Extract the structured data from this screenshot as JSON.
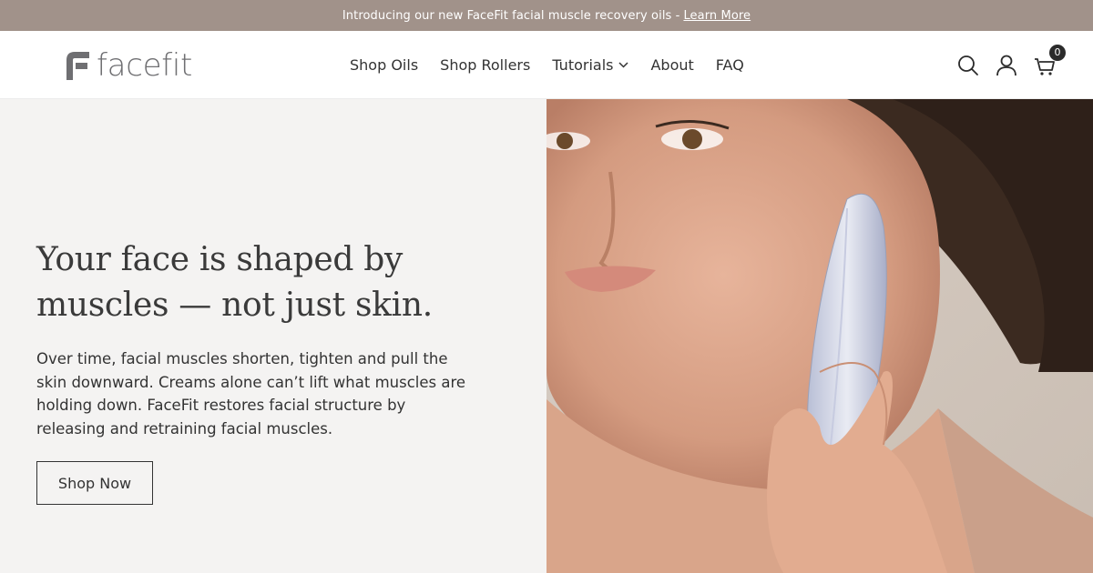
{
  "announcement": {
    "text": "Introducing our new FaceFit facial muscle recovery oils -",
    "link_label": "Learn More"
  },
  "header": {
    "logo_text": "facefit",
    "nav": [
      {
        "label": "Shop Oils"
      },
      {
        "label": "Shop Rollers"
      },
      {
        "label": "Tutorials",
        "has_dropdown": true
      },
      {
        "label": "About"
      },
      {
        "label": "FAQ"
      }
    ],
    "icons": [
      "search-icon",
      "account-icon",
      "cart-icon"
    ],
    "cart_count": "0"
  },
  "hero": {
    "title": "Your face is shaped by muscles — not just skin.",
    "body": "Over time, facial muscles shorten, tighten and pull the skin downward. Creams alone can’t lift what muscles are holding down. FaceFit restores facial structure by releasing and retraining facial muscles.",
    "button_label": "Shop Now",
    "image_subject": "woman using a facial roller tool on her jaw"
  },
  "colors": {
    "announcement_bg": "#a1928a",
    "hero_bg": "#f4f3f2",
    "text": "#2b2b2b",
    "logo": "#6f6f72"
  }
}
